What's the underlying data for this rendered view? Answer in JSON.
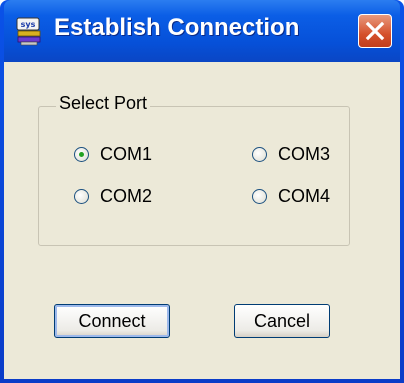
{
  "window": {
    "title": "Establish Connection",
    "icon": "serial-port-app-icon",
    "close_icon": "close-icon",
    "accent": "#0a52e8",
    "close_color": "#d5512c"
  },
  "port_group": {
    "label": "Select Port",
    "options": [
      {
        "label": "COM1",
        "checked": true
      },
      {
        "label": "COM2",
        "checked": false
      },
      {
        "label": "COM3",
        "checked": false
      },
      {
        "label": "COM4",
        "checked": false
      }
    ]
  },
  "buttons": {
    "connect": "Connect",
    "cancel": "Cancel"
  }
}
